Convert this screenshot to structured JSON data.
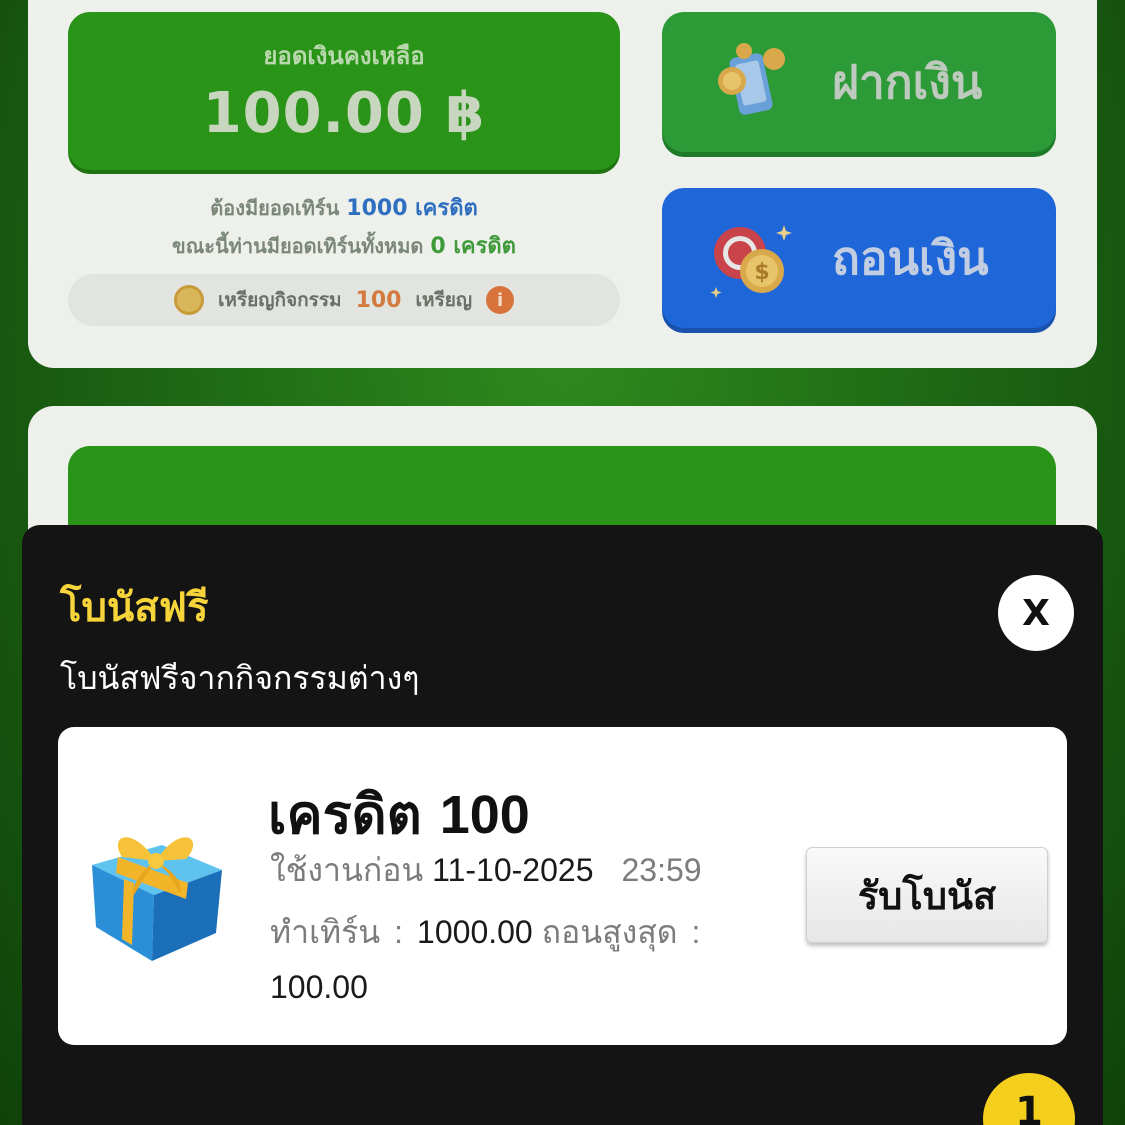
{
  "balance": {
    "label": "ยอดเงินคงเหลือ",
    "amount": "100.00 ฿"
  },
  "turnover": {
    "required_prefix": "ต้องมียอดเทิร์น",
    "required_value": "1000 เครดิต",
    "current_prefix": "ขณะนี้ท่านมียอดเทิร์นทั้งหมด",
    "current_value": "0 เครดิต"
  },
  "coins": {
    "label": "เหรียญกิจกรรม",
    "value": "100",
    "unit": "เหรียญ",
    "info_icon": "i"
  },
  "actions": {
    "deposit_label": "ฝากเงิน",
    "withdraw_label": "ถอนเงิน"
  },
  "modal": {
    "title": "โบนัสฟรี",
    "subtitle": "โบนัสฟรีจากกิจกรรมต่างๆ",
    "close_label": "X",
    "badge_count": "1",
    "bonus": {
      "credit_label": "เครดิต",
      "credit_value": "100",
      "expiry_label": "ใช้งานก่อน",
      "expiry_date": "11-10-2025",
      "expiry_time": "23:59",
      "turnover_label": "ทำเทิร์น",
      "turnover_value": "1000.00",
      "max_withdraw_label": "ถอนสูงสุด",
      "max_withdraw_value": "100.00",
      "colon": ":",
      "claim_label": "รับโบนัส"
    }
  },
  "colors": {
    "accent_yellow": "#f7d53a",
    "deposit_green": "#2c9a37",
    "withdraw_blue": "#1f67d8",
    "sheet_bg": "#141414"
  },
  "icons": {
    "deposit": "phone-coin-icon",
    "withdraw": "casino-chip-coin-icon",
    "gift": "gift-box-icon",
    "coin": "coin-icon",
    "info": "info-icon",
    "close": "close-icon"
  }
}
